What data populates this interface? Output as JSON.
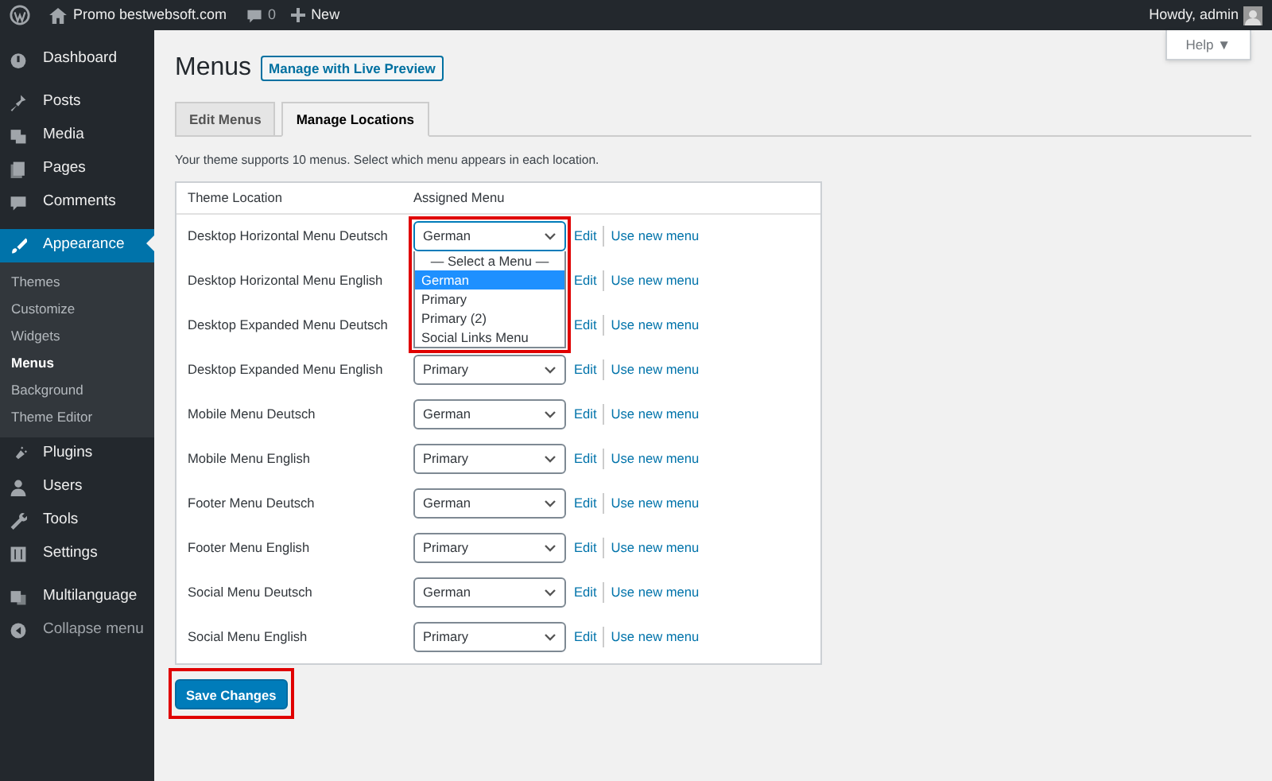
{
  "top_bar": {
    "site": "Promo bestwebsoft.com",
    "comments": "0",
    "new": "New",
    "greeting": "Howdy, admin"
  },
  "sidebar": {
    "items": [
      {
        "label": "Dashboard",
        "kind": "gauge",
        "selected": false
      },
      {
        "label": "Posts",
        "kind": "pin",
        "selected": false
      },
      {
        "label": "Media",
        "kind": "media",
        "selected": false
      },
      {
        "label": "Pages",
        "kind": "pages",
        "selected": false
      },
      {
        "label": "Comments",
        "kind": "bubble",
        "selected": false
      },
      {
        "label": "Appearance",
        "kind": "brush",
        "selected": true,
        "children": [
          {
            "label": "Themes",
            "selected": false
          },
          {
            "label": "Customize",
            "selected": false
          },
          {
            "label": "Widgets",
            "selected": false
          },
          {
            "label": "Menus",
            "selected": true
          },
          {
            "label": "Background",
            "selected": false
          },
          {
            "label": "Theme Editor",
            "selected": false
          }
        ]
      },
      {
        "label": "Plugins",
        "kind": "plug",
        "selected": false
      },
      {
        "label": "Users",
        "kind": "user",
        "selected": false
      },
      {
        "label": "Tools",
        "kind": "wrench",
        "selected": false
      },
      {
        "label": "Settings",
        "kind": "sliders",
        "selected": false
      },
      {
        "label": "Multilanguage",
        "kind": "globe",
        "selected": false
      },
      {
        "label": "Collapse menu",
        "kind": "collapse",
        "selected": false
      }
    ]
  },
  "help": "Help ▼",
  "title": "Menus",
  "live_preview": "Manage with Live Preview",
  "tabs": [
    {
      "label": "Edit Menus",
      "selected": false
    },
    {
      "label": "Manage Locations",
      "selected": true
    }
  ],
  "intro": "Your theme supports 10 menus. Select which menu appears in each location.",
  "table": {
    "columns": [
      "Theme Location",
      "Assigned Menu"
    ],
    "rows": [
      {
        "location": "Desktop Horizontal Menu Deutsch",
        "menu": "German",
        "edit": "Edit",
        "new_menu": "Use new menu",
        "dropdown": {
          "open": true,
          "highlighted": true,
          "options": [
            {
              "label": "— Select a Menu —",
              "selected": false
            },
            {
              "label": "German",
              "selected": true
            },
            {
              "label": "Primary",
              "selected": false
            },
            {
              "label": "Primary (2)",
              "selected": false
            },
            {
              "label": "Social Links Menu",
              "selected": false
            }
          ]
        }
      },
      {
        "location": "Desktop Horizontal Menu English",
        "edit": "Edit",
        "new_menu": "Use new menu"
      },
      {
        "location": "Desktop Expanded Menu Deutsch",
        "edit": "Edit",
        "new_menu": "Use new menu"
      },
      {
        "location": "Desktop Expanded Menu English",
        "menu": "Primary",
        "edit": "Edit",
        "new_menu": "Use new menu"
      },
      {
        "location": "Mobile Menu Deutsch",
        "menu": "German",
        "edit": "Edit",
        "new_menu": "Use new menu"
      },
      {
        "location": "Mobile Menu English",
        "menu": "Primary",
        "edit": "Edit",
        "new_menu": "Use new menu"
      },
      {
        "location": "Footer Menu Deutsch",
        "menu": "German",
        "edit": "Edit",
        "new_menu": "Use new menu"
      },
      {
        "location": "Footer Menu English",
        "menu": "Primary",
        "edit": "Edit",
        "new_menu": "Use new menu"
      },
      {
        "location": "Social Menu Deutsch",
        "menu": "German",
        "edit": "Edit",
        "new_menu": "Use new menu"
      },
      {
        "location": "Social Menu English",
        "menu": "Primary",
        "edit": "Edit",
        "new_menu": "Use new menu"
      }
    ]
  },
  "save": {
    "label": "Save Changes",
    "highlighted": true
  }
}
